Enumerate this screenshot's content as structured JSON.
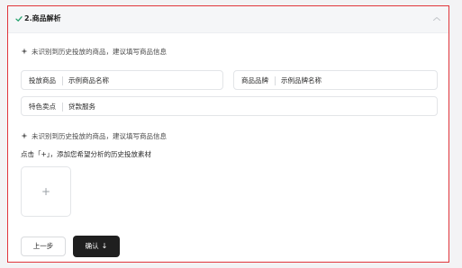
{
  "section": {
    "title": "2.商品解析",
    "accent_color": "#e0353b",
    "status_icon": "check-icon",
    "collapse_icon": "chevron-up-icon"
  },
  "hint_top": {
    "icon": "sparkle-icon",
    "text": "未识别到历史投放的商品，建议填写商品信息"
  },
  "fields": {
    "product": {
      "label": "投放商品",
      "value": "示例商品名称"
    },
    "brand": {
      "label": "商品品牌",
      "value": "示例品牌名称"
    },
    "features": {
      "label": "特色卖点",
      "value": "贷款服务"
    }
  },
  "hint_bottom": {
    "icon": "sparkle-icon",
    "text": "未识别到历史投放的商品，建议填写商品信息"
  },
  "upload": {
    "instruction": "点击「+」，添加您希望分析的历史投放素材",
    "plus_label": "+"
  },
  "buttons": {
    "prev_label": "上一步",
    "confirm_label": "确认",
    "confirm_icon": "arrow-down-icon",
    "confirm_arrow": "↓"
  }
}
